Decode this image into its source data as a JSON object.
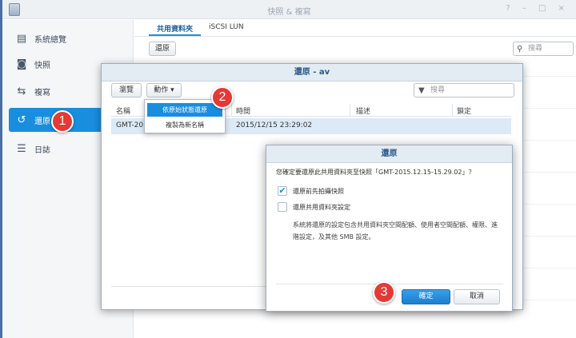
{
  "window": {
    "title": "快照 & 複寫",
    "controls": "? – □ ×"
  },
  "sidebar": {
    "items": [
      {
        "label": "系統總覽",
        "icon": "overview-icon"
      },
      {
        "label": "快照",
        "icon": "camera-icon"
      },
      {
        "label": "複寫",
        "icon": "replication-icon"
      },
      {
        "label": "還原",
        "icon": "restore-icon",
        "active": true
      },
      {
        "label": "日誌",
        "icon": "log-icon"
      }
    ]
  },
  "main": {
    "tabs": [
      "共用資料夾",
      "iSCSI LUN"
    ],
    "restore_button": "還原",
    "search_placeholder": "搜尋"
  },
  "restore_dialog": {
    "title": "還原 - av",
    "browse_button": "瀏覽",
    "action_button": "動作 ▾",
    "filter_placeholder": "搜尋",
    "columns": [
      "名稱",
      "時間",
      "描述",
      "鎖定"
    ],
    "row": {
      "name": "GMT-201",
      "time": "2015/12/15 23:29:02"
    }
  },
  "action_menu": {
    "items": [
      "依原始狀態還原",
      "複製為新名稱"
    ]
  },
  "confirm_dialog": {
    "title": "還原",
    "question": "您確定要還原此共用資料夾至快照「GMT-2015.12.15-15.29.02」？",
    "option1": "還原前先拍攝快照",
    "option1_checked": true,
    "option2": "還原共用資料夾設定",
    "option2_checked": false,
    "note": "系統將還原的設定包含共用資料夾空間配額、使用者空間配額、權限、進階設定，及其他 SMB 設定。",
    "ok": "確定",
    "cancel": "取消"
  },
  "steps": [
    "1",
    "2",
    "3"
  ],
  "colors": {
    "accent": "#1a8ede",
    "badge": "#e53935"
  }
}
